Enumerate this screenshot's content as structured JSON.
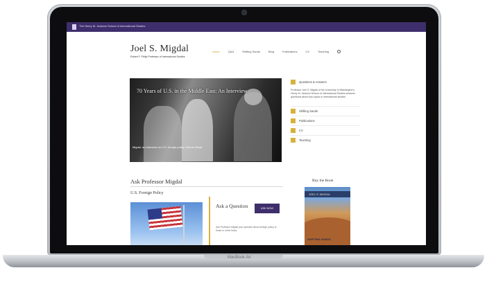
{
  "device": {
    "model_label": "MacBook Air"
  },
  "site": {
    "topbar_text": "The Henry M. Jackson School of International Studies",
    "name": "Joel S. Migdal",
    "subtitle": "Robert F. Philip Professor of International Studies",
    "nav": [
      {
        "label": "Home",
        "active": true
      },
      {
        "label": "Q&A",
        "active": false
      },
      {
        "label": "Shifting Sands",
        "active": false
      },
      {
        "label": "Blog",
        "active": false
      },
      {
        "label": "Publications",
        "active": false
      },
      {
        "label": "CV",
        "active": false
      },
      {
        "label": "Teaching",
        "active": false
      }
    ]
  },
  "hero": {
    "headline": "70 Years of U.S. in the Middle East: An Interview",
    "caption": "Migdal: an interview on U.S. foreign policy. Click to Read"
  },
  "sidebar": {
    "header": "Questions & Answers",
    "intro": "Professor Joel S. Migdal of the University of Washington's Henry M. Jackson School of International Studies answers questions about key topics in international studies",
    "links": [
      "Shifting Sands",
      "Publications",
      "CV",
      "Teaching"
    ]
  },
  "ask": {
    "title": "Ask Professor Migdal",
    "topic": "U.S. Foreign Policy",
    "box_title": "Ask a Question",
    "button": "ASK NOW",
    "box_text": "Ask Professor Migdal your question about foreign policy or those in of the times"
  },
  "book": {
    "section_title": "Buy the Book",
    "cover_top": "JOEL S. MIGDAL",
    "cover_bottom": "SHIFTING SANDS"
  },
  "colors": {
    "topbar": "#3e2e6b",
    "accent": "#d7b13c",
    "button": "#3e2e6b"
  }
}
